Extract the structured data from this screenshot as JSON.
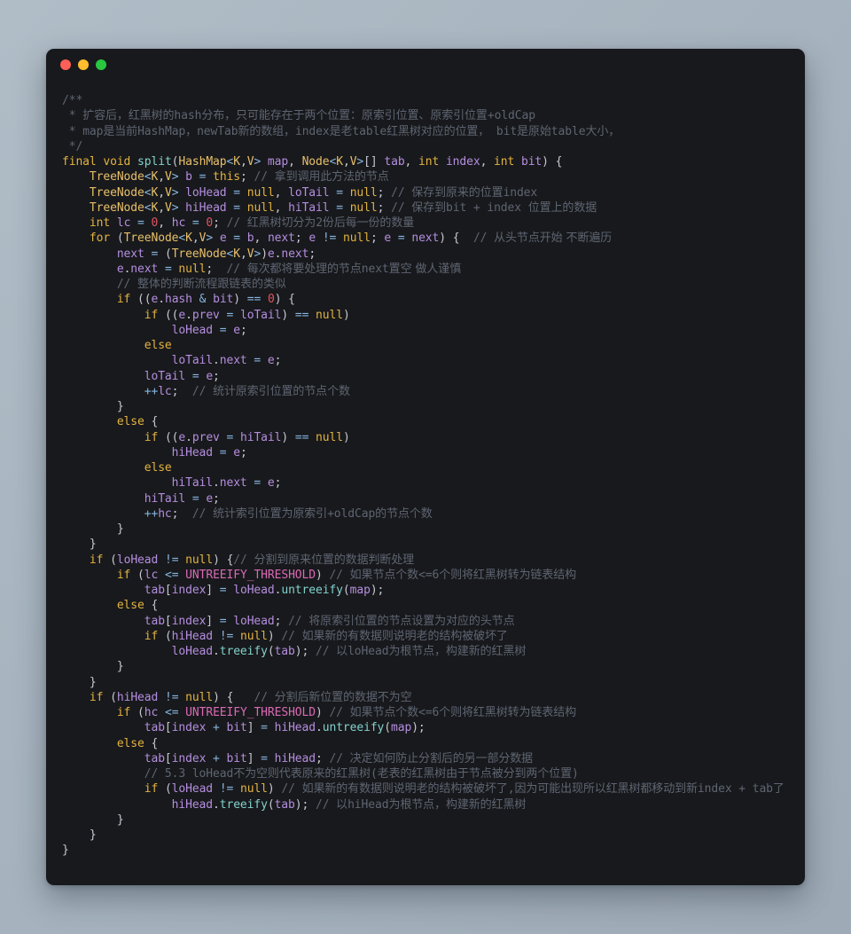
{
  "window": {
    "name": "code-snippet-window",
    "background_color": "#18191c",
    "page_background_color": "#a7b4bf",
    "traffic_lights": [
      {
        "name": "close",
        "label": "Close",
        "color": "#fe5f57"
      },
      {
        "name": "minimize",
        "label": "Minimize",
        "color": "#febc2e"
      },
      {
        "name": "maximize",
        "label": "Maximize",
        "color": "#28c840"
      }
    ]
  },
  "editor": {
    "language": "java",
    "font_size": "13px",
    "theme_colors": {
      "comment": "#5e6572",
      "keyword": "#e3b341",
      "type": "#e8c06a",
      "function": "#82d2ce",
      "identifier": "#b58ee0",
      "operator": "#86b5e0",
      "null_literal": "#e3b341",
      "number": "#e05561",
      "constant": "#d96ab5",
      "punctuation": "#c7c9d1",
      "foreground": "#c7c9d1"
    },
    "code_lines": [
      "/**",
      " * 扩容后，红黑树的hash分布，只可能存在于两个位置：原索引位置、原索引位置+oldCap",
      " * map是当前HashMap，newTab新的数组，index是老table红黑树对应的位置， bit是原始table大小，",
      " */",
      "final void split(HashMap<K,V> map, Node<K,V>[] tab, int index, int bit) {",
      "    TreeNode<K,V> b = this; // 拿到调用此方法的节点",
      "    TreeNode<K,V> loHead = null, loTail = null; // 保存到原来的位置index",
      "    TreeNode<K,V> hiHead = null, hiTail = null; // 保存到bit + index 位置上的数据",
      "    int lc = 0, hc = 0; // 红黑树切分为2份后每一份的数量",
      "    for (TreeNode<K,V> e = b, next; e != null; e = next) {  // 从头节点开始 不断遍历",
      "        next = (TreeNode<K,V>)e.next;",
      "        e.next = null;  // 每次都将要处理的节点next置空 做人谨慎",
      "        // 整体的判断流程跟链表的类似",
      "        if ((e.hash & bit) == 0) {",
      "            if ((e.prev = loTail) == null)",
      "                loHead = e;",
      "            else",
      "                loTail.next = e;",
      "            loTail = e;",
      "            ++lc;  // 统计原索引位置的节点个数",
      "        }",
      "        else {",
      "            if ((e.prev = hiTail) == null)",
      "                hiHead = e;",
      "            else",
      "                hiTail.next = e;",
      "            hiTail = e;",
      "            ++hc;  // 统计索引位置为原索引+oldCap的节点个数",
      "        }",
      "    }",
      "    if (loHead != null) {// 分割到原来位置的数据判断处理",
      "        if (lc <= UNTREEIFY_THRESHOLD) // 如果节点个数<=6个则将红黑树转为链表结构",
      "            tab[index] = loHead.untreeify(map);",
      "        else {",
      "            tab[index] = loHead; // 将原索引位置的节点设置为对应的头节点",
      "            if (hiHead != null) // 如果新的有数据则说明老的结构被破坏了",
      "                loHead.treeify(tab); // 以loHead为根节点，构建新的红黑树",
      "        }",
      "    }",
      "    if (hiHead != null) {   // 分割后新位置的数据不为空",
      "        if (hc <= UNTREEIFY_THRESHOLD) // 如果节点个数<=6个则将红黑树转为链表结构",
      "            tab[index + bit] = hiHead.untreeify(map);",
      "        else {",
      "            tab[index + bit] = hiHead; // 决定如何防止分割后的另一部分数据",
      "            // 5.3 loHead不为空则代表原来的红黑树(老表的红黑树由于节点被分到两个位置)",
      "            if (loHead != null) // 如果新的有数据则说明老的结构被破坏了,因为可能出现所以红黑树都移动到新index + tab了",
      "                hiHead.treeify(tab); // 以hiHead为根节点，构建新的红黑树",
      "        }",
      "    }",
      "}"
    ]
  }
}
